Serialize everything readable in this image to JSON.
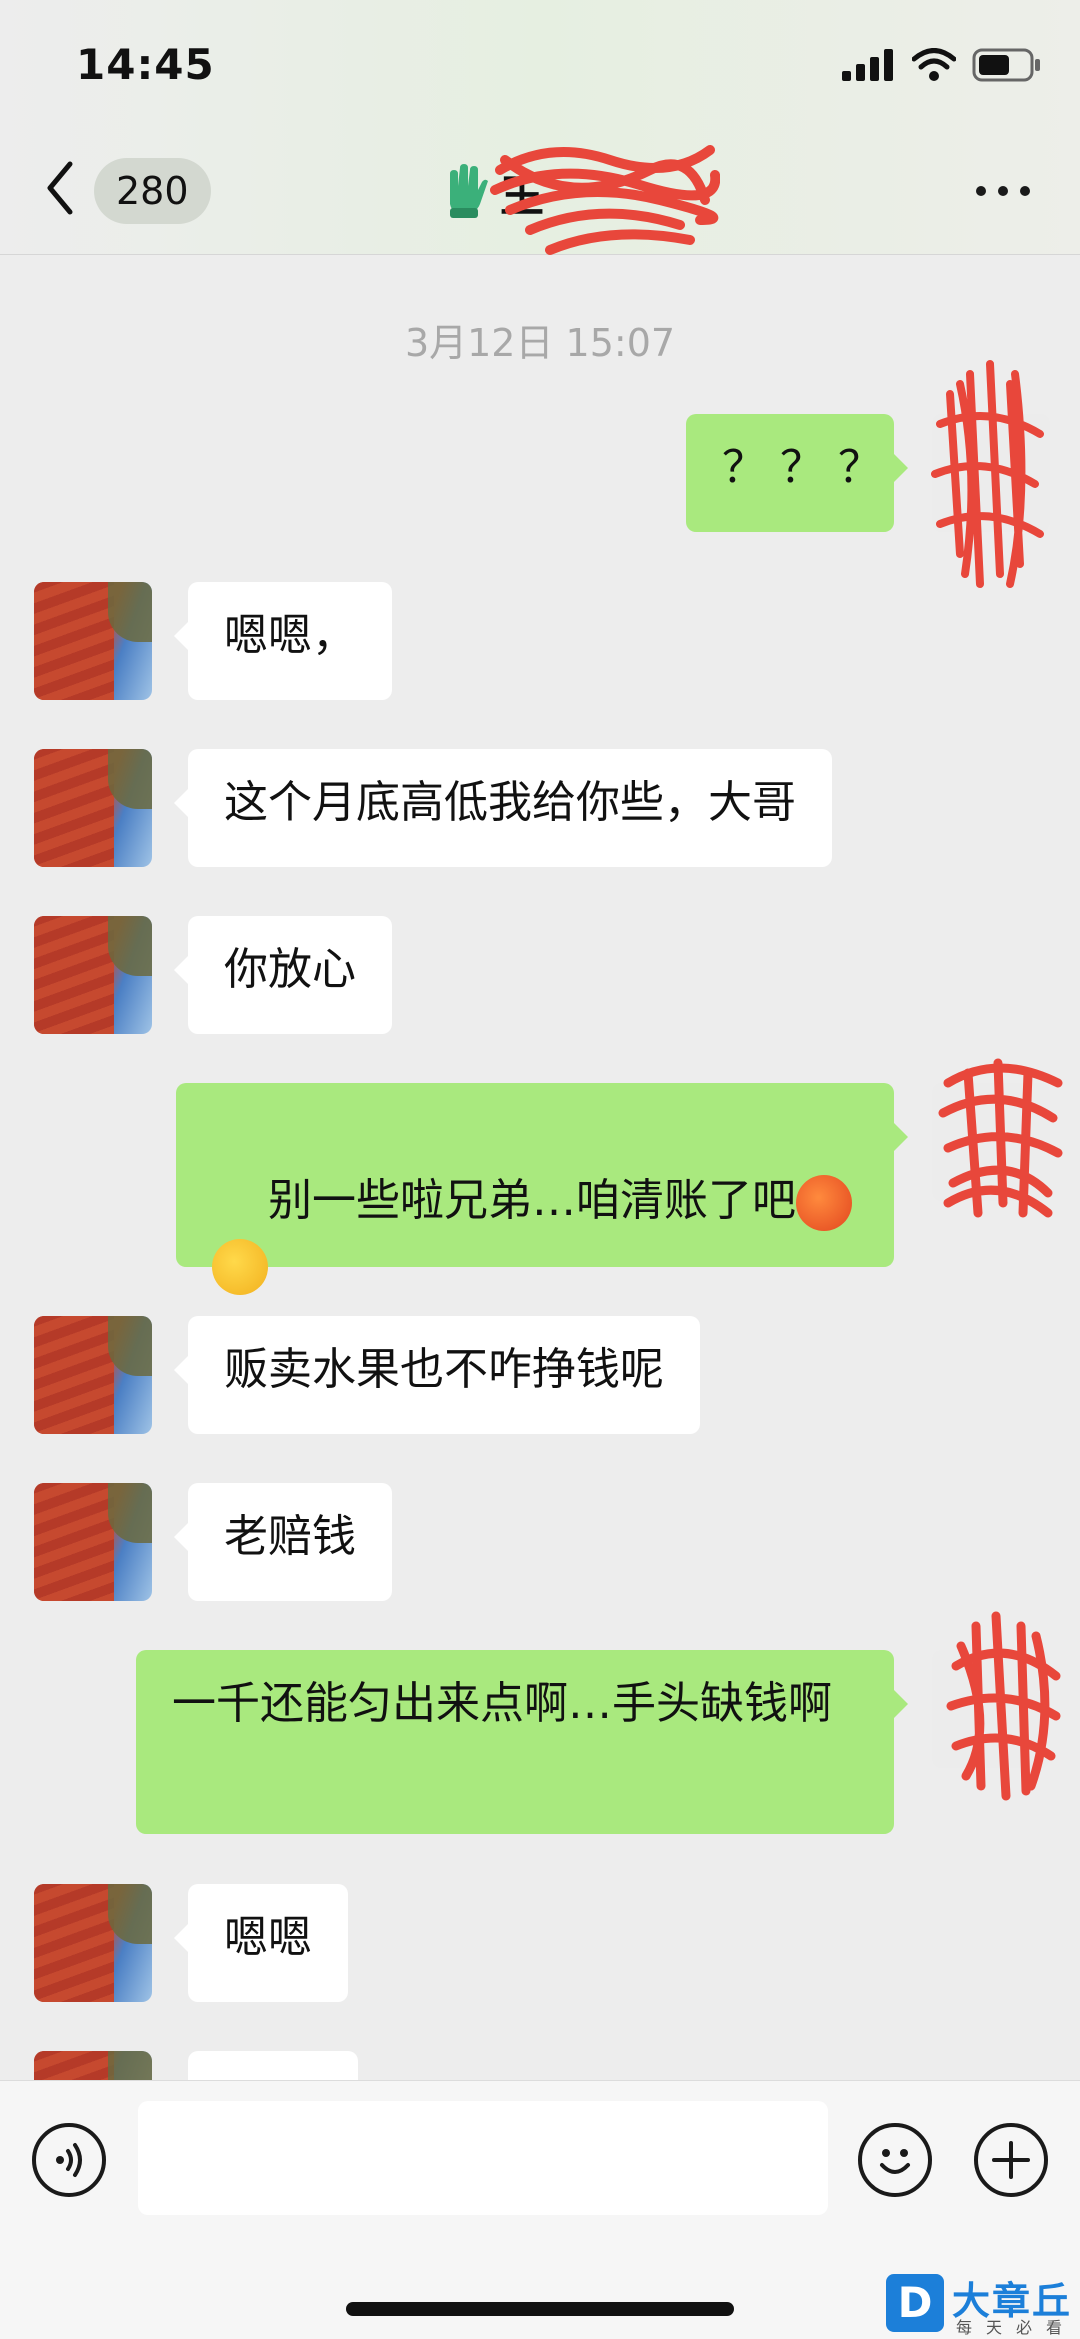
{
  "status_bar": {
    "time": "14:45"
  },
  "header": {
    "unread_count": "280",
    "title_visible": "王"
  },
  "chat": {
    "timestamp": "3月12日 15:07",
    "messages": [
      {
        "side": "right",
        "text": "？？？"
      },
      {
        "side": "left",
        "text": "嗯嗯，"
      },
      {
        "side": "left",
        "text": "这个月底高低我给你些，大哥"
      },
      {
        "side": "left",
        "text": "你放心"
      },
      {
        "side": "right",
        "text": "别一些啦兄弟…咱清账了吧",
        "emojis": [
          "hot-face-emoji",
          "laughing-crying-emoji"
        ]
      },
      {
        "side": "left",
        "text": "贩卖水果也不咋挣钱呢"
      },
      {
        "side": "left",
        "text": "老赔钱"
      },
      {
        "side": "right",
        "text": "一千还能匀出来点啊…手头缺钱啊"
      },
      {
        "side": "left",
        "text": "嗯嗯"
      }
    ]
  },
  "colors": {
    "sent_bubble": "#a9e97e",
    "received_bubble": "#ffffff",
    "background": "#ededed",
    "scribble": "#e8473b"
  },
  "watermark": {
    "badge": "D",
    "title": "大章丘",
    "subtitle": "每天必看"
  }
}
